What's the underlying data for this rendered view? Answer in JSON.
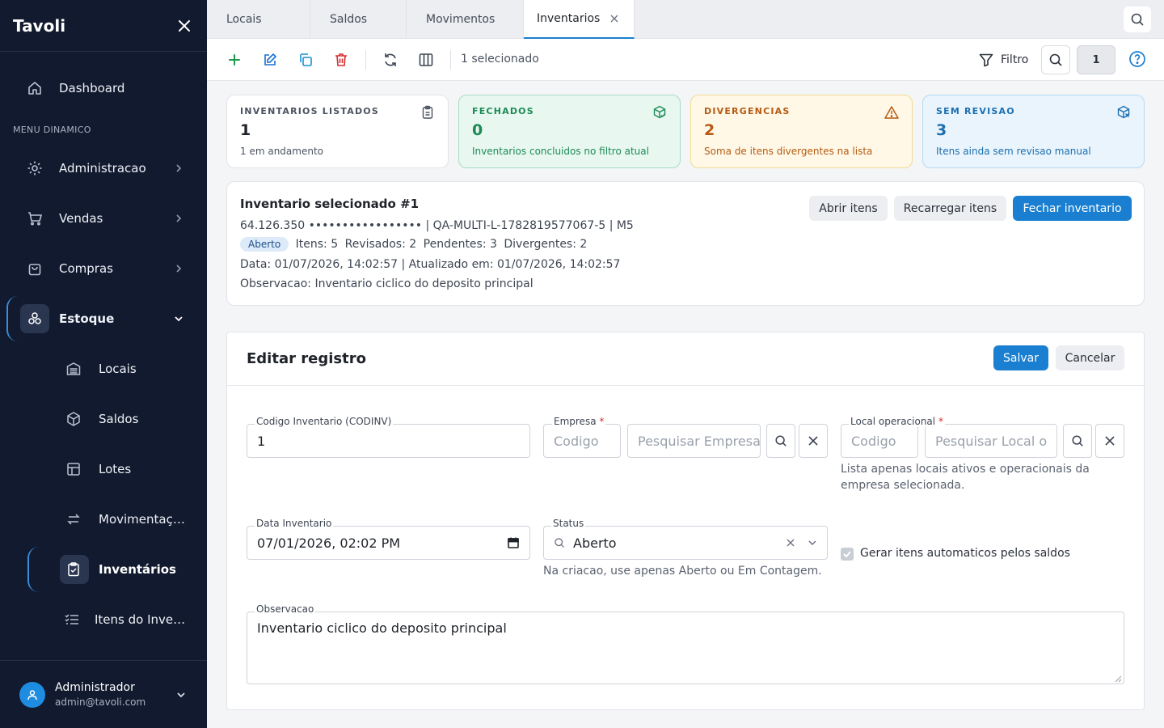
{
  "app": {
    "name": "Tavoli"
  },
  "sidebar": {
    "dashboard": "Dashboard",
    "section": "MENU DINAMICO",
    "items": [
      "Administracao",
      "Vendas",
      "Compras",
      "Estoque"
    ],
    "sub_items": [
      "Locais",
      "Saldos",
      "Lotes",
      "Movimentação...",
      "Inventários",
      "Itens do Inven..."
    ],
    "user": {
      "name": "Administrador",
      "email": "admin@tavoli.com"
    }
  },
  "tabs": [
    "Locais",
    "Saldos",
    "Movimentos",
    "Inventarios"
  ],
  "toolbar": {
    "selected_text": "1 selecionado",
    "filter_label": "Filtro",
    "page": "1"
  },
  "cards": [
    {
      "title": "INVENTARIOS LISTADOS",
      "value": "1",
      "subtitle": "1 em andamento",
      "icon": "clipboard-icon"
    },
    {
      "title": "FECHADOS",
      "value": "0",
      "subtitle": "Inventarios concluidos no filtro atual",
      "icon": "package-check-icon"
    },
    {
      "title": "DIVERGENCIAS",
      "value": "2",
      "subtitle": "Soma de itens divergentes na lista",
      "icon": "warning-icon"
    },
    {
      "title": "SEM REVISAO",
      "value": "3",
      "subtitle": "Itens ainda sem revisao manual",
      "icon": "package-x-icon"
    }
  ],
  "selected": {
    "title": "Inventario selecionado #1",
    "line1": "64.126.350 ••••••••••••••••• | QA-MULTI-L-1782819577067-5 | M5",
    "status": "Aberto",
    "stats": [
      "Itens: 5",
      "Revisados: 2",
      "Pendentes: 3",
      "Divergentes: 2"
    ],
    "dates": "Data: 01/07/2026, 14:02:57 | Atualizado em: 01/07/2026, 14:02:57",
    "note": "Observacao: Inventario ciclico do deposito principal",
    "buttons": {
      "open": "Abrir itens",
      "reload": "Recarregar itens",
      "close": "Fechar inventario"
    }
  },
  "form": {
    "title": "Editar registro",
    "save": "Salvar",
    "cancel": "Cancelar",
    "codigo_label": "Codigo Inventario (CODINV)",
    "codigo_value": "1",
    "empresa_label": "Empresa",
    "empresa_code_ph": "Codigo",
    "empresa_search_ph": "Pesquisar Empresa",
    "local_label": "Local operacional",
    "local_code_ph": "Codigo",
    "local_search_ph": "Pesquisar Local o",
    "local_hint": "Lista apenas locais ativos e operacionais da empresa selecionada.",
    "data_label": "Data Inventario",
    "data_value": "07/01/2026, 02:02 PM",
    "status_label": "Status",
    "status_value": "Aberto",
    "status_hint": "Na criacao, use apenas Aberto ou Em Contagem.",
    "gerar_label": "Gerar itens automaticos pelos saldos",
    "obs_label": "Observacao",
    "obs_value": "Inventario ciclico do deposito principal",
    "required_mark": "*"
  },
  "colors": {
    "sidebar_bg": "#111a2e",
    "primary": "#1a7fd0",
    "green": "#1c8a55",
    "amber": "#b55a12",
    "blue": "#1b6fb0",
    "danger": "#d62d2d"
  }
}
